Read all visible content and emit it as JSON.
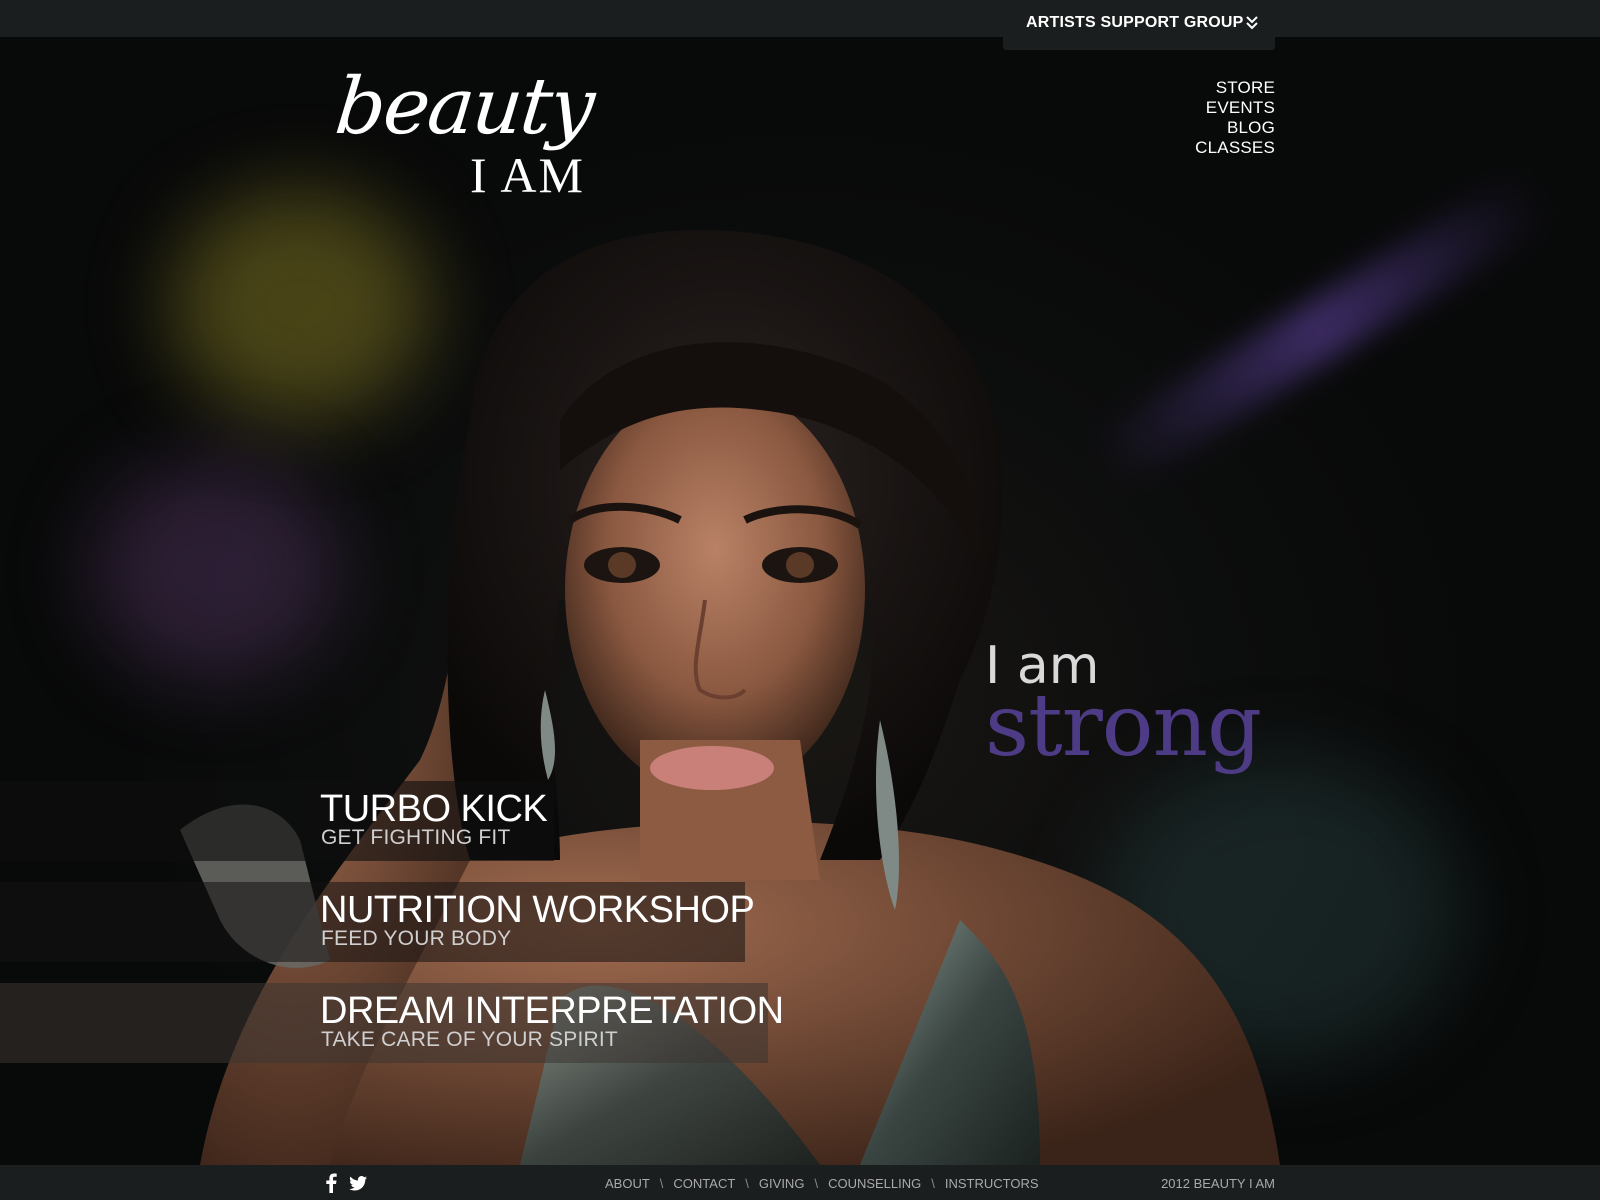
{
  "header": {
    "dropdown_label": "ARTISTS SUPPORT GROUP",
    "dropdown_icon": "double-chevron-down-icon"
  },
  "logo": {
    "line1": "beauty",
    "line2": "I AM"
  },
  "nav": {
    "items": [
      "STORE",
      "EVENTS",
      "BLOG",
      "CLASSES"
    ]
  },
  "tagline": {
    "prefix": "I am",
    "word": "strong",
    "word_color": "#4e3b85"
  },
  "promos": [
    {
      "title": "TURBO KICK",
      "subtitle": "GET FIGHTING FIT"
    },
    {
      "title": "NUTRITION WORKSHOP",
      "subtitle": "FEED YOUR BODY"
    },
    {
      "title": "DREAM INTERPRETATION",
      "subtitle": "TAKE CARE OF YOUR SPIRIT"
    }
  ],
  "footer": {
    "social_icons": [
      "facebook-icon",
      "twitter-icon"
    ],
    "links": [
      "ABOUT",
      "CONTACT",
      "GIVING",
      "COUNSELLING",
      "INSTRUCTORS"
    ],
    "copyright": "2012 BEAUTY I AM"
  },
  "colors": {
    "bar_background": "#1b1e1e",
    "accent_purple": "#4e3b85"
  }
}
